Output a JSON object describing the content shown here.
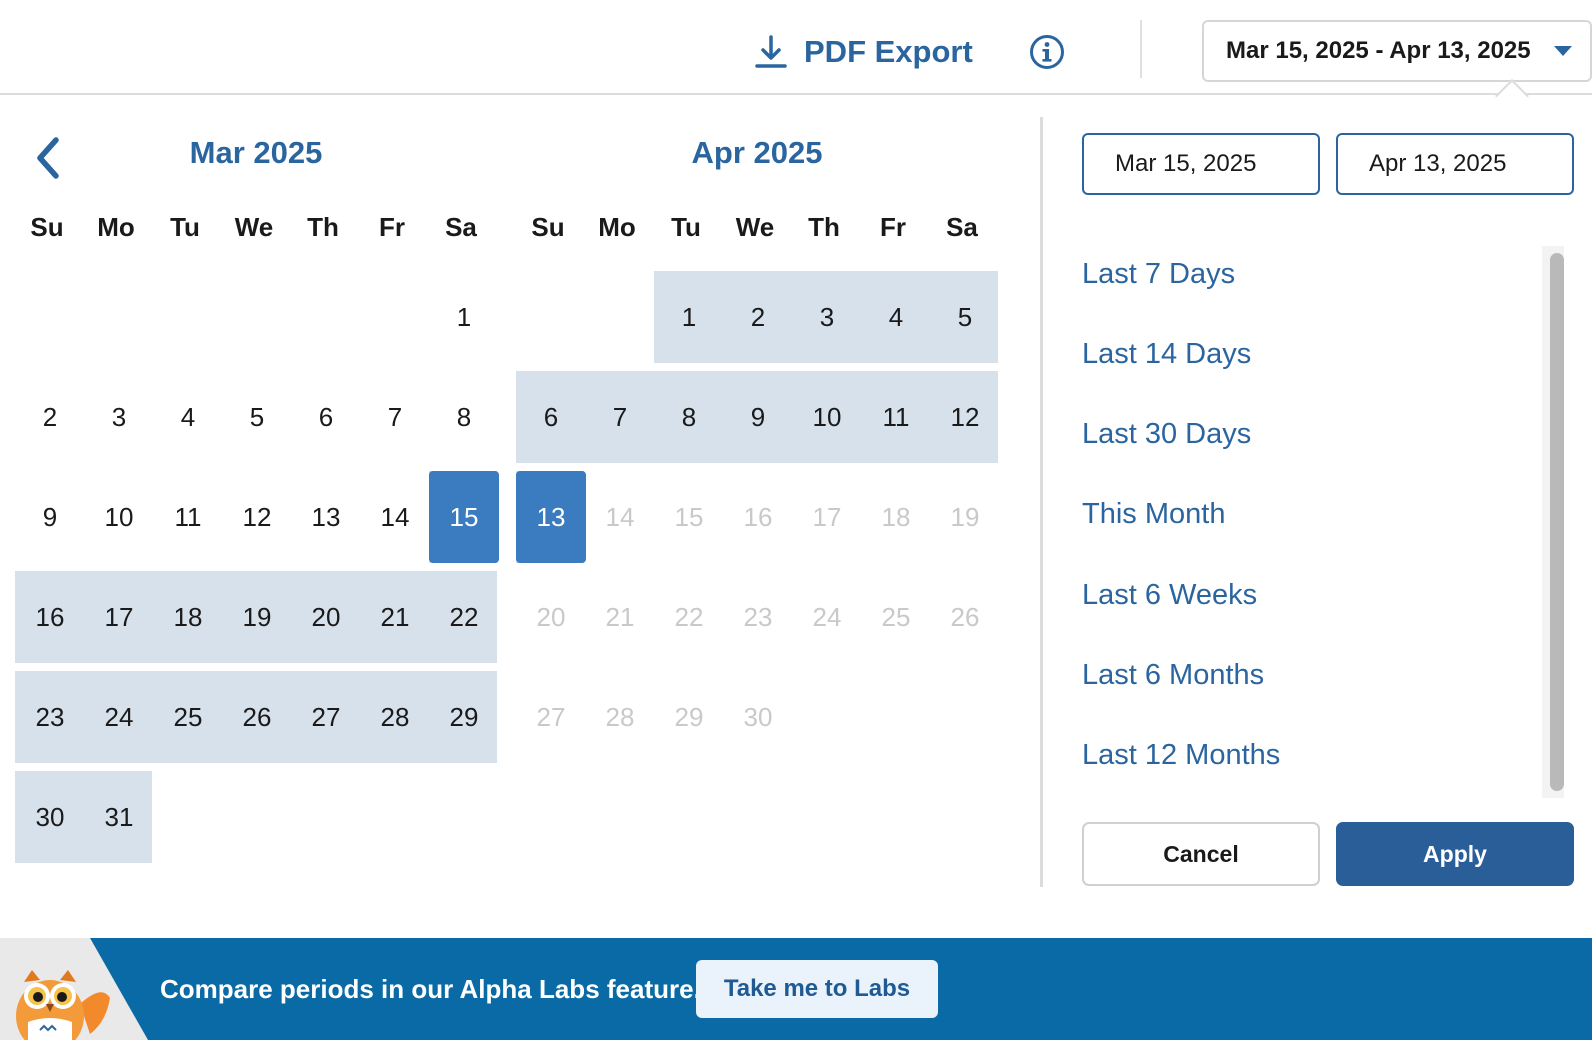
{
  "toolbar": {
    "pdf_export_label": "PDF Export",
    "date_range_value": "Mar 15, 2025 - Apr 13, 2025"
  },
  "calendar": {
    "months": [
      {
        "title": "Mar 2025",
        "weekdays": [
          "Su",
          "Mo",
          "Tu",
          "We",
          "Th",
          "Fr",
          "Sa"
        ],
        "first_weekday": 6,
        "days_in_month": 31,
        "range_start_day": 15,
        "range_end_day": 31,
        "disabled_after": null
      },
      {
        "title": "Apr 2025",
        "weekdays": [
          "Su",
          "Mo",
          "Tu",
          "We",
          "Th",
          "Fr",
          "Sa"
        ],
        "first_weekday": 2,
        "days_in_month": 30,
        "range_start_day": 1,
        "range_end_day": 13,
        "disabled_after": 13
      }
    ],
    "selected_start": {
      "month": "Mar 2025",
      "day": 15
    },
    "selected_end": {
      "month": "Apr 2025",
      "day": 13
    }
  },
  "panel": {
    "start_input_value": "Mar 15, 2025",
    "end_input_value": "Apr 13, 2025",
    "presets": [
      "Last 7 Days",
      "Last 14 Days",
      "Last 30 Days",
      "This Month",
      "Last 6 Weeks",
      "Last 6 Months",
      "Last 12 Months"
    ],
    "cancel_label": "Cancel",
    "apply_label": "Apply"
  },
  "banner": {
    "text": "Compare periods in our Alpha Labs feature.",
    "button_label": "Take me to Labs"
  },
  "colors": {
    "accent": "#2a659f",
    "selected_day": "#3b7bbf",
    "range_fill": "#d6e1ec",
    "banner_bg": "#0a6aa5",
    "apply_bg": "#2a5e98"
  },
  "icons": [
    "download-icon",
    "info-icon",
    "chevron-down-icon",
    "chevron-left-icon",
    "owl-mascot-icon"
  ]
}
